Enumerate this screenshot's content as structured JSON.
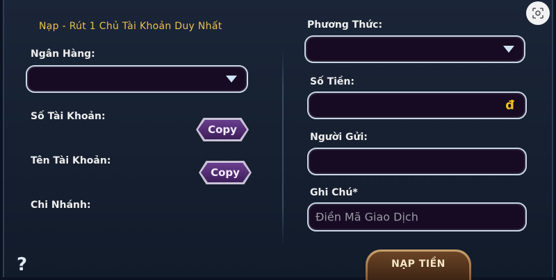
{
  "notice": "Nạp - Rút 1 Chủ Tài Khoản Duy Nhất",
  "left": {
    "bank_label": "Ngân Hàng:",
    "bank_value": "",
    "account_number_label": "Số Tài Khoản:",
    "account_name_label": "Tên Tài Khoản:",
    "branch_label": "Chi Nhánh:",
    "copy_label": "Copy"
  },
  "right": {
    "method_label": "Phương Thức:",
    "method_value": "",
    "amount_label": "Số Tiền:",
    "currency_symbol": "đ",
    "sender_label": "Người Gửi:",
    "note_label": "Ghi Chú*",
    "note_placeholder": "Điền Mã Giao Dịch"
  },
  "submit_label": "NẠP TIỀN",
  "help_symbol": "?",
  "icons": {
    "dropdown": "chevron-down-icon",
    "help": "help-icon",
    "lens": "lens-icon"
  },
  "colors": {
    "notice": "#e8c050",
    "field_bg": "#160b22",
    "field_border": "#c9d7e6",
    "copy_button": "#5a3480",
    "submit_button": "#6b4426"
  }
}
